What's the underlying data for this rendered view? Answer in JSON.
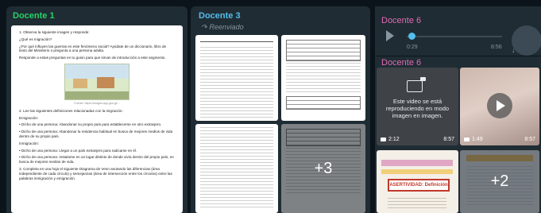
{
  "colors": {
    "bg": "#0b141a",
    "bubble": "#1f2c33",
    "sender1": "#25d366",
    "sender2": "#53bdeb",
    "sender3": "#e26ab6",
    "meta": "#8696a0"
  },
  "column1": {
    "sender": "Docente 1",
    "doc": {
      "q1": "1. Observa la siguiente imagen y responde:",
      "q1a": "¿Qué es migración?",
      "q1b": "¿Por qué influyen las guerras en este fenómeno social? Ayúdate de un diccionario, libro de texto del Ministerio o pregunta a una persona adulta.",
      "q1c": "Responde a estas preguntas en tu guion para que sirvan de introducción a este segmento.",
      "caption": "Fuente: https://images.app.goo.gl/...",
      "q2": "2. Lee las siguientes definiciones relacionadas con la migración:",
      "emig_title": "Emigración:",
      "emig_1": "• Dícho de una persona: Abandonar su propio país para establecerse en otro extranjero.",
      "emig_2": "• Dicho de una persona: Abandonar la residencia habitual en busca de mejores medios de vida dentro de su propio país.",
      "inmig_title": "Inmigración:",
      "inmig_1": "• Dicho de una persona: Llegar a un país extranjero para radicarse en él.",
      "inmig_2": "• Dicho de una persona: Instalarse en un lugar distinto de donde vivía dentro del propio país, en busca de mejores medios de vida.",
      "q3": "3. Completa en una hoja el siguiente Diagrama de Venn anotando las diferencias (área independiente de cada círculo) y semejanzas (área de intersección entre los círculos) entre las palabras inmigración y emigración."
    }
  },
  "column2": {
    "sender": "Docente 3",
    "forwarded_label": "Reenviado",
    "overlay_count": "+3"
  },
  "column3": {
    "audio": {
      "sender": "Docente 6",
      "current_time": "0:29",
      "duration": "8:56",
      "progress": 0.05
    },
    "media": {
      "sender": "Docente 6",
      "video1_message": "Este video se está reproduciendo en modo imagen en imagen.",
      "video1_duration": "2:12",
      "video1_time": "8:57",
      "video2_duration": "1:49",
      "video2_time": "8:57",
      "poster_title": "ASERTIVIDAD: Definición",
      "overlay_count": "+2"
    }
  }
}
